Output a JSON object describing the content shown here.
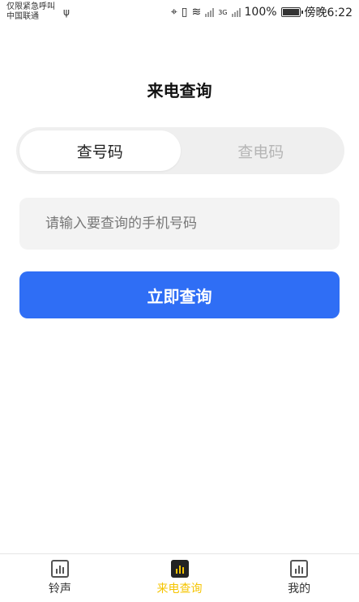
{
  "status_bar": {
    "carrier_line1": "仅限紧急呼叫",
    "carrier_line2": "中国联通",
    "network": "3G",
    "battery": "100%",
    "battery_level": 100,
    "time": "傍晚6:22"
  },
  "page": {
    "title": "来电查询"
  },
  "tabs": [
    {
      "label": "查号码",
      "active": true
    },
    {
      "label": "查电码",
      "active": false
    }
  ],
  "search": {
    "placeholder": "请输入要查询的手机号码",
    "value": ""
  },
  "query_button": {
    "label": "立即查询"
  },
  "bottom_nav": [
    {
      "label": "铃声",
      "icon": "chart-icon"
    },
    {
      "label": "来电查询",
      "icon": "chart-icon",
      "active": true
    },
    {
      "label": "我的",
      "icon": "chart-icon"
    }
  ],
  "colors": {
    "accent": "#2f6ef5",
    "nav_active": "#f5c400"
  }
}
